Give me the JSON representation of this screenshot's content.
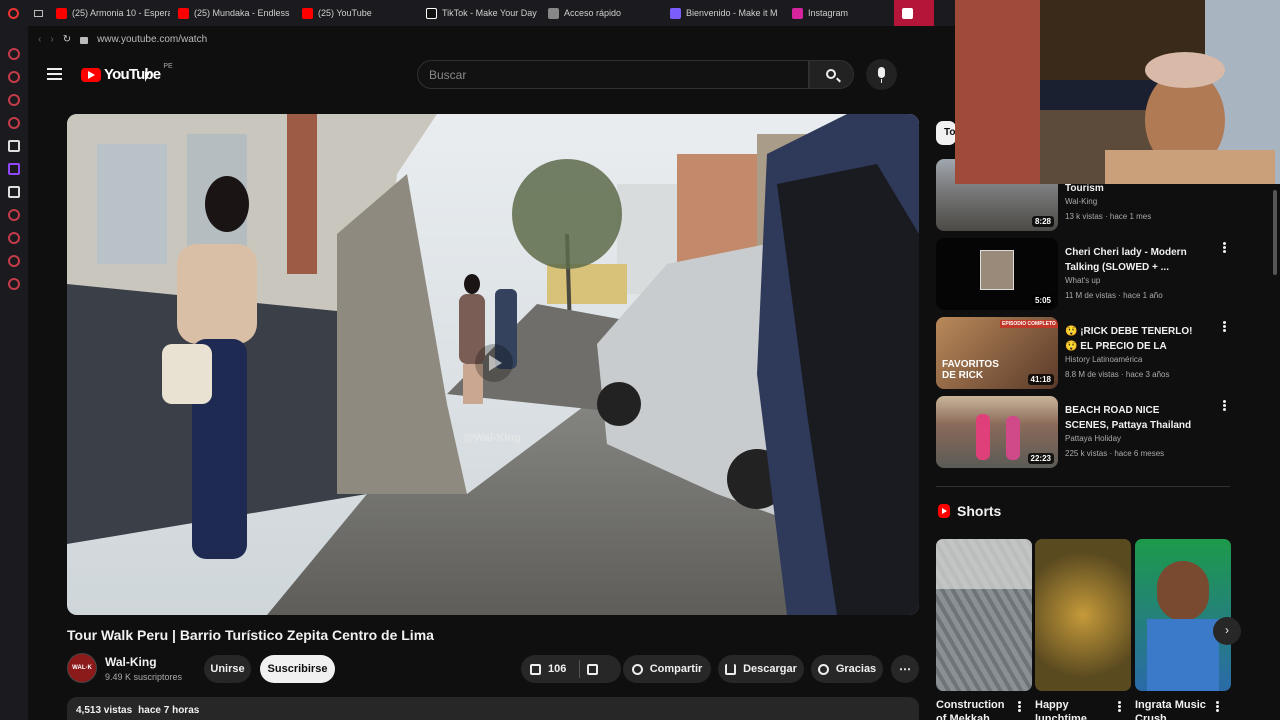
{
  "browser": {
    "tabs": [
      {
        "label": "(25) Armonia 10 - Espera",
        "icon_color": "#ff0000"
      },
      {
        "label": "(25) Mundaka - Endless",
        "icon_color": "#ff0000"
      },
      {
        "label": "(25) YouTube",
        "icon_color": "#ff0000"
      },
      {
        "label": "TikTok - Make Your Day",
        "icon_color": "#111111"
      },
      {
        "label": "Acceso rápido",
        "icon_color": "#888888"
      },
      {
        "label": "Bienvenido - Make it M",
        "icon_color": "#7a5cff"
      },
      {
        "label": "Instagram",
        "icon_color": "#d6249f"
      }
    ],
    "url": "www.youtube.com/watch"
  },
  "header": {
    "logo_text": "YouTube",
    "country_code": "PE",
    "search_placeholder": "Buscar"
  },
  "video": {
    "watermark": "@Wal-King",
    "title": "Tour Walk Peru | Barrio Turístico Zepita Centro de Lima",
    "channel_name": "Wal-King",
    "channel_avatar_text": "WAL·K",
    "subscribers": "9.49 K suscriptores",
    "join_label": "Unirse",
    "subscribe_label": "Suscribirse",
    "likes": "106",
    "share_label": "Compartir",
    "download_label": "Descargar",
    "thanks_label": "Gracias",
    "views": "4,513 vistas",
    "age": "hace 7 horas"
  },
  "recommendations": {
    "chip_label": "To",
    "items": [
      {
        "title": "Barrio Zepita Walking Tourism",
        "channel": "Wal-King",
        "meta": "13 k vistas · hace 1 mes",
        "duration": "8:28"
      },
      {
        "title": "Cheri Cheri lady - Modern Talking (SLOWED + ...",
        "channel": "What's up",
        "meta": "11 M de vistas · hace 1 año",
        "duration": "5:05"
      },
      {
        "title": "😲 ¡RICK DEBE TENERLO! 😲 EL PRECIO DE LA HISTORIA ...",
        "channel": "History Latinoamérica",
        "meta": "8.8 M de vistas · hace 3 años",
        "duration": "41:18",
        "overlay": "FAVORITOS DE RICK",
        "badge": "EPISODIO COMPLETO"
      },
      {
        "title": "BEACH ROAD NICE SCENES, Pattaya Thailand",
        "channel": "Pattaya Holiday",
        "meta": "225 k vistas · hace 6 meses",
        "duration": "22:23"
      }
    ]
  },
  "shorts": {
    "heading": "Shorts",
    "items": [
      {
        "title": "Construction of Mekkah"
      },
      {
        "title": "Happy lunchtime"
      },
      {
        "title": "Ingrata Music Crush"
      }
    ]
  },
  "colors": {
    "brand": "#ff0000",
    "background": "#0f0f0f",
    "surface": "#272727"
  }
}
